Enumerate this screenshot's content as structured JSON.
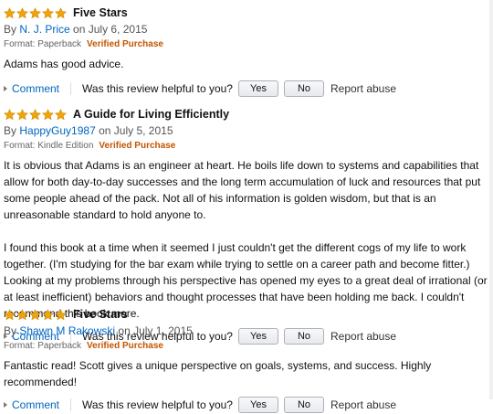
{
  "reviews": [
    {
      "stars": 5,
      "title": "Five Stars",
      "by": "By",
      "author": "N. J. Price",
      "date": "on July 6, 2015",
      "format": "Format: Paperback",
      "verified": "Verified Purchase",
      "body": [
        "Adams has good advice."
      ]
    },
    {
      "stars": 5,
      "title": "A Guide for Living Efficiently",
      "by": "By",
      "author": "HappyGuy1987",
      "date": "on July 5, 2015",
      "format": "Format: Kindle Edition",
      "verified": "Verified Purchase",
      "body": [
        "It is obvious that Adams is an engineer at heart. He boils life down to systems and capabilities that allow for both day-to-day successes and the long term accumulation of luck and resources that put some people ahead of the pack. Not all of his information is golden wisdom, but that is an unreasonable standard to hold anyone to.",
        "I found this book at a time when it seemed I just couldn't get the different cogs of my life to work together. (I'm studying for the bar exam while trying to settle on a career path and become fitter.) Looking at my problems through his perspective has opened my eyes to a great deal of irrational (or at least inefficient) behaviors and thought processes that have been holding me back. I couldn't recommend this book more."
      ]
    },
    {
      "stars": 5,
      "title": "Five Stars",
      "by": "By",
      "author": "Shawn M Rakowski",
      "date": "on July 1, 2015",
      "format": "Format: Paperback",
      "verified": "Verified Purchase",
      "body": [
        "Fantastic read! Scott gives a unique perspective on goals, systems, and success. Highly recommended!"
      ]
    }
  ],
  "actions": {
    "comment": "Comment",
    "helpful_q": "Was this review helpful to you?",
    "yes": "Yes",
    "no": "No",
    "report": "Report abuse"
  },
  "colors": {
    "star": "#f0a30a",
    "link": "#0066c0",
    "verified": "#c45500"
  },
  "icons": {
    "star": "star-icon",
    "caret": "caret-right-icon"
  }
}
